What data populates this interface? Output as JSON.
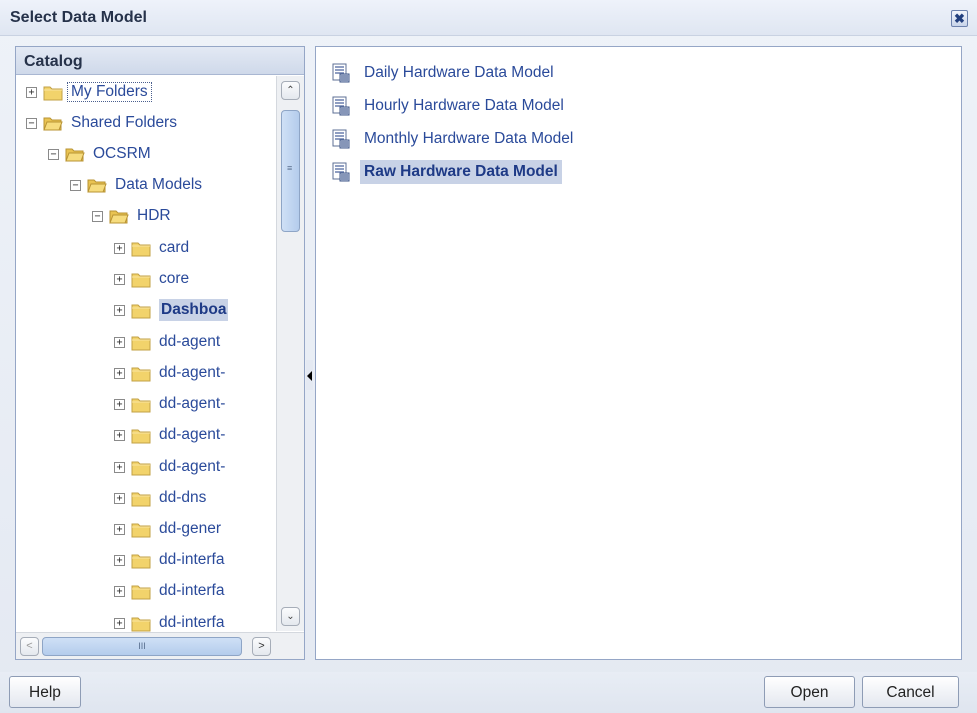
{
  "dialog": {
    "title": "Select Data Model",
    "close_glyph": "✖"
  },
  "catalog": {
    "header": "Catalog",
    "tree": [
      {
        "label": "My Folders",
        "expander": "+",
        "focused": true
      },
      {
        "label": "Shared Folders",
        "expander": "−"
      },
      {
        "label": "OCSRM",
        "expander": "−"
      },
      {
        "label": "Data Models",
        "expander": "−"
      },
      {
        "label": "HDR",
        "expander": "−"
      },
      {
        "label": "card",
        "expander": "+"
      },
      {
        "label": "core",
        "expander": "+"
      },
      {
        "label": "Dashboa",
        "expander": "+",
        "selected": true
      },
      {
        "label": "dd-agent",
        "expander": "+"
      },
      {
        "label": "dd-agent-",
        "expander": "+"
      },
      {
        "label": "dd-agent-",
        "expander": "+"
      },
      {
        "label": "dd-agent-",
        "expander": "+"
      },
      {
        "label": "dd-agent-",
        "expander": "+"
      },
      {
        "label": "dd-dns",
        "expander": "+"
      },
      {
        "label": "dd-gener",
        "expander": "+"
      },
      {
        "label": "dd-interfa",
        "expander": "+"
      },
      {
        "label": "dd-interfa",
        "expander": "+"
      },
      {
        "label": "dd-interfa",
        "expander": "+"
      }
    ],
    "scroll": {
      "up": "⌃",
      "down": "⌄",
      "left": "<",
      "right": ">",
      "thumb_grip": "≡",
      "hthumb_grip": "III"
    }
  },
  "data_models": [
    {
      "label": "Daily Hardware Data Model"
    },
    {
      "label": "Hourly Hardware Data Model"
    },
    {
      "label": "Monthly Hardware Data Model"
    },
    {
      "label": "Raw Hardware Data Model",
      "selected": true
    }
  ],
  "footer": {
    "help": "Help",
    "open": "Open",
    "cancel": "Cancel"
  },
  "colors": {
    "link": "#2a4a9a",
    "selection": "#c8d2e6",
    "folder": "#f2d36b"
  }
}
